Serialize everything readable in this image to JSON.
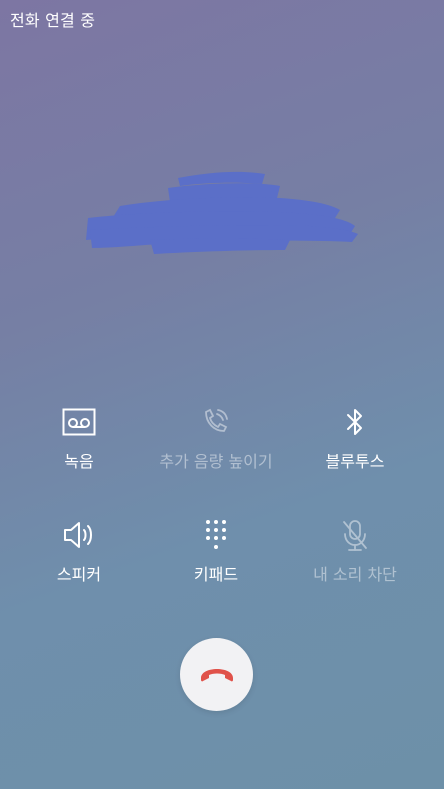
{
  "status": {
    "title": "전화 연결 중"
  },
  "controls": {
    "record": {
      "label": "녹음",
      "icon": "voicemail-icon",
      "enabled": true
    },
    "extra_volume": {
      "label": "추가 음량 높이기",
      "icon": "phone-volume-icon",
      "enabled": false
    },
    "bluetooth": {
      "label": "블루투스",
      "icon": "bluetooth-icon",
      "enabled": true
    },
    "speaker": {
      "label": "스피커",
      "icon": "speaker-icon",
      "enabled": true
    },
    "keypad": {
      "label": "키패드",
      "icon": "keypad-icon",
      "enabled": true
    },
    "mute": {
      "label": "내 소리 차단",
      "icon": "mic-off-icon",
      "enabled": false
    }
  },
  "end_call": {
    "icon": "end-call-icon",
    "color": "#e0524a"
  },
  "colors": {
    "background_top": "#7d76a3",
    "background_bottom": "#6d90a8",
    "redaction": "#5b6fc8"
  }
}
